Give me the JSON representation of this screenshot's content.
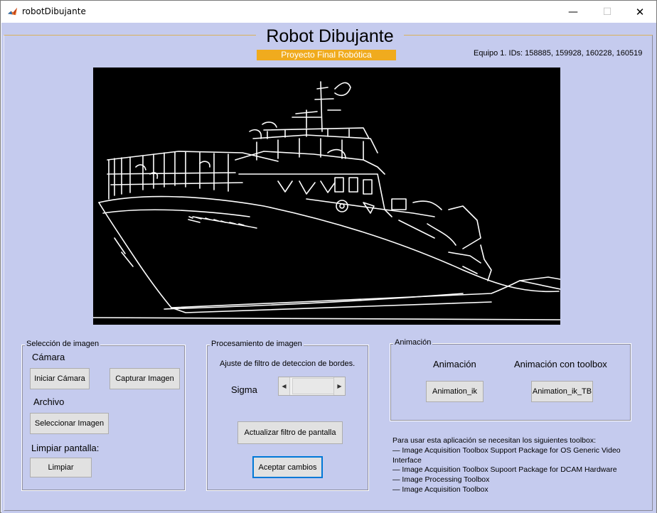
{
  "window": {
    "title": "robotDibujante",
    "minimize_glyph": "—",
    "maximize_glyph": "☐",
    "close_glyph": "✕",
    "icon": "matlab-icon"
  },
  "header": {
    "title": "Robot Dibujante",
    "subtitle": "Proyecto Final Robótica",
    "team": "Equipo 1. IDs: 158885, 159928, 160228, 160519"
  },
  "image_panel": {
    "content": "edge-detected ship image"
  },
  "seleccion": {
    "title": "Selección de imagen",
    "camera_label": "Cámara",
    "start_camera": "Iniciar Cámara",
    "capture_image": "Capturar Imagen",
    "file_label": "Archivo",
    "select_image": "Seleccionar Imagen",
    "clear_label": "Limpiar pantalla:",
    "clear_button": "Limpiar"
  },
  "procesamiento": {
    "title": "Procesamiento de imagen",
    "description": "Ajuste de filtro de deteccion de bordes.",
    "sigma_label": "Sigma",
    "update_button": "Actualizar filtro de pantalla",
    "accept_button": "Aceptar cambios"
  },
  "animacion": {
    "title": "Animación",
    "col1_label": "Animación",
    "col2_label": "Animación con toolbox",
    "btn1": "Animation_ik",
    "btn2": "Animation_ik_TB"
  },
  "info": {
    "lines": [
      "Para usar esta aplicación se necesitan los siguientes toolbox:",
      "— Image Acquisition Toolbox Support Package for OS Generic Video Interface",
      "— Image Acquisition Toolbox Supoort Package for DCAM Hardware",
      "— Image Processing Toolbox",
      "— Image Acquisition Toolbox"
    ]
  },
  "colors": {
    "figure_bg": "#c5cbee",
    "subtitle_bg": "#f0ab1e",
    "image_bg": "#000000",
    "edges": "#ffffff"
  }
}
